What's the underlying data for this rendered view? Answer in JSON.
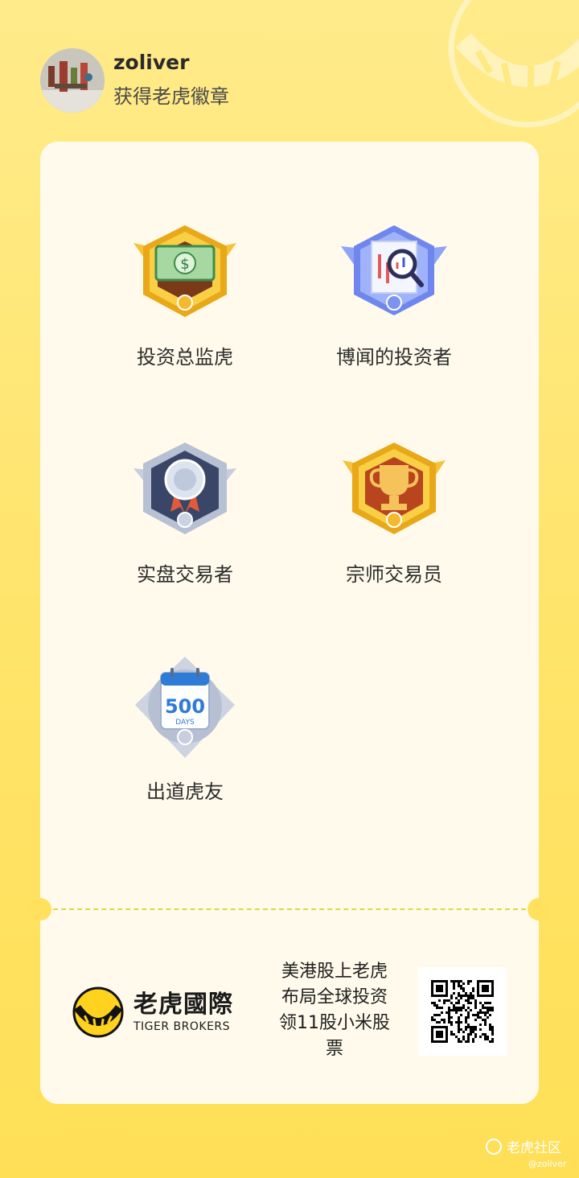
{
  "header": {
    "username": "zoliver",
    "subtitle": "获得老虎徽章"
  },
  "badges": [
    {
      "name": "投资总监虎",
      "icon": "money-badge-icon"
    },
    {
      "name": "博闻的投资者",
      "icon": "magnifier-chart-badge-icon"
    },
    {
      "name": "实盘交易者",
      "icon": "silver-medal-badge-icon"
    },
    {
      "name": "宗师交易员",
      "icon": "trophy-badge-icon"
    },
    {
      "name": "出道虎友",
      "icon": "calendar-badge-icon",
      "calendar_number": "500",
      "calendar_unit": "DAYS"
    }
  ],
  "footer": {
    "brand_cn": "老虎國際",
    "brand_en": "TIGER BROKERS",
    "promo": [
      "美港股上老虎",
      "布局全球投资",
      "领11股小米股",
      "票"
    ],
    "qr_icon": "qr-code-icon"
  },
  "watermark": {
    "text": "老虎社区",
    "handle": "@zoliver"
  },
  "colors": {
    "background": "#FFE46A",
    "card": "#FFFAEB",
    "brand_yellow": "#FFD21F",
    "dashed_line": "#D6DA4C"
  }
}
